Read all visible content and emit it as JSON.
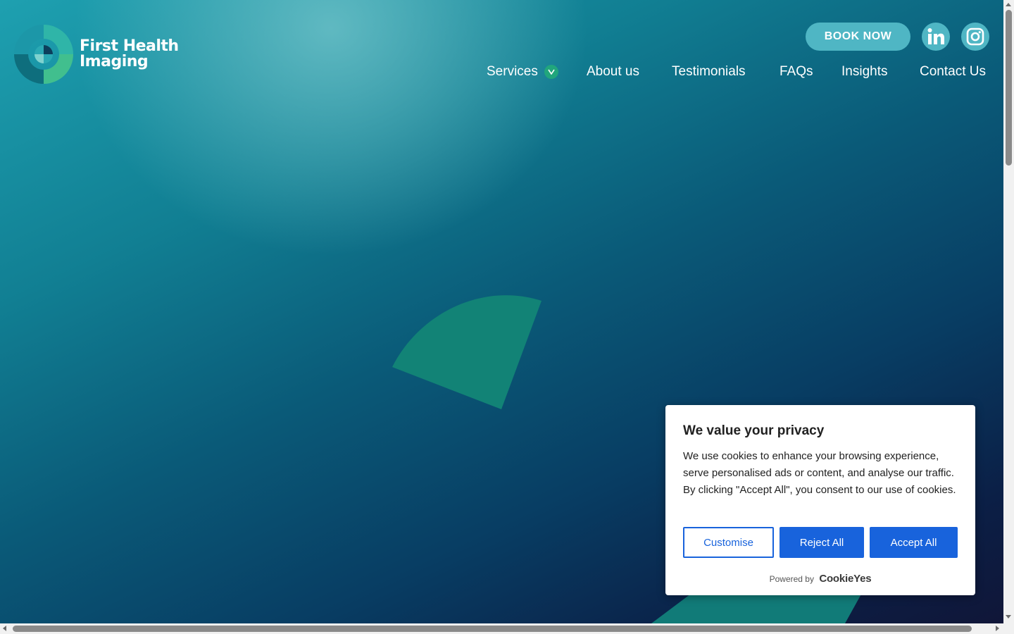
{
  "brand": {
    "name_line1": "First Health",
    "name_line2": "Imaging",
    "colors": {
      "primary": "#4fb6c4",
      "accent": "#21a67c",
      "dark": "#0b1f46"
    }
  },
  "header": {
    "book_button": "BOOK NOW",
    "social": [
      {
        "name": "linkedin-icon",
        "glyph": "in"
      },
      {
        "name": "instagram-icon"
      }
    ]
  },
  "nav": {
    "items": [
      {
        "label": "Services",
        "has_dropdown": true,
        "dropdown_glyph": "V"
      },
      {
        "label": "About us"
      },
      {
        "label": "Testimonials"
      },
      {
        "label": "FAQs"
      },
      {
        "label": "Insights"
      },
      {
        "label": "Contact Us"
      }
    ]
  },
  "cookie_banner": {
    "title": "We value your privacy",
    "body": "We use cookies to enhance your browsing experience, serve personalised ads or content, and analyse our traffic. By clicking \"Accept All\", you consent to our use of cookies.",
    "customise_label": "Customise",
    "reject_label": "Reject All",
    "accept_label": "Accept All",
    "powered_by": "Powered by",
    "powered_brand": "CookieYes",
    "button_color": "#1863dc"
  }
}
